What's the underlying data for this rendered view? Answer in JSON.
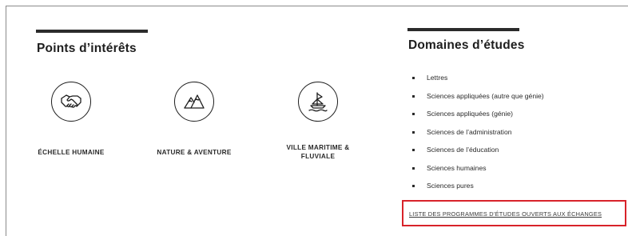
{
  "interests": {
    "title": "Points d’intérêts",
    "items": [
      {
        "label": "ÉCHELLE HUMAINE",
        "icon": "handshake-icon"
      },
      {
        "label": "NATURE & AVENTURE",
        "icon": "mountains-icon"
      },
      {
        "label_line1": "VILLE MARITIME &",
        "label_line2": "FLUVIALE",
        "icon": "sailboat-icon"
      }
    ]
  },
  "domains": {
    "title": "Domaines d’études",
    "items": [
      "Lettres",
      "Sciences appliquées (autre que génie)",
      "Sciences appliquées (génie)",
      "Sciences de l’administration",
      "Sciences de l’éducation",
      "Sciences humaines",
      "Sciences pures"
    ],
    "link_label": "LISTE DES PROGRAMMES D’ÉTUDES OUVERTS AUX ÉCHANGES"
  },
  "colors": {
    "accent_bar": "#2b2b2b",
    "highlight_border": "#d8232a",
    "text": "#1e1e1e"
  }
}
